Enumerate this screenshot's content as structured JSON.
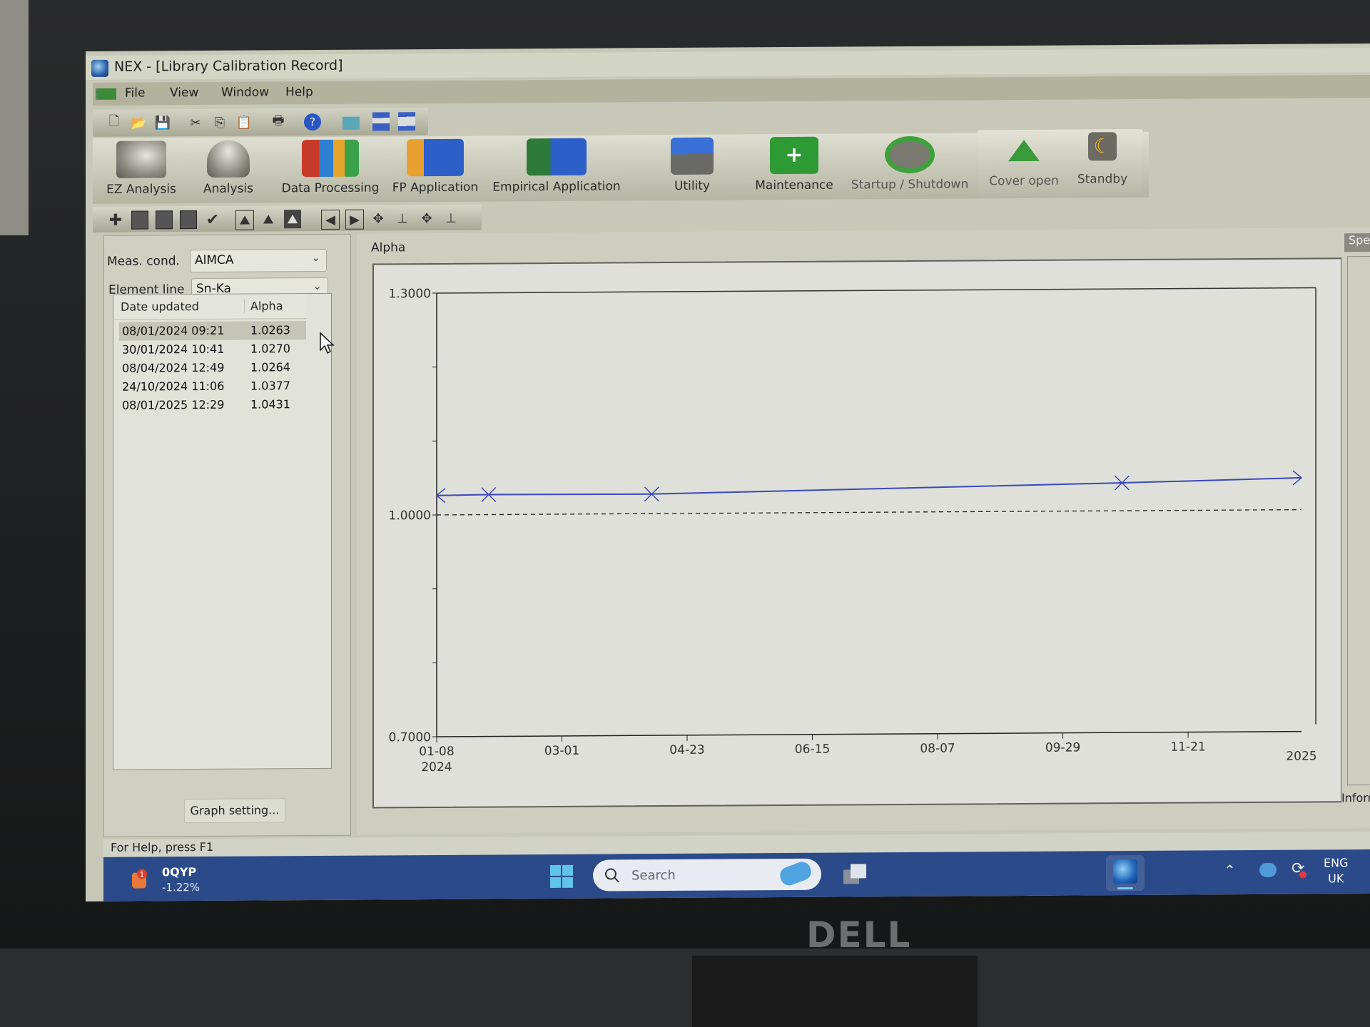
{
  "window": {
    "title": "NEX - [Library Calibration Record]"
  },
  "menu": {
    "items": [
      {
        "label": "File"
      },
      {
        "label": "View"
      },
      {
        "label": "Window"
      },
      {
        "label": "Help"
      }
    ]
  },
  "toolbar_standard": {
    "icons": [
      "new-file-icon",
      "open-folder-icon",
      "save-icon",
      "cut-icon",
      "copy-icon",
      "paste-icon",
      "print-icon",
      "help-icon",
      "window-icon",
      "cascade-icon",
      "tile-icon"
    ]
  },
  "toolbar_main": {
    "buttons": [
      {
        "label": "EZ Analysis",
        "icon": "ez-analysis-icon"
      },
      {
        "label": "Analysis",
        "icon": "analysis-icon"
      },
      {
        "label": "Data Processing",
        "icon": "data-processing-icon"
      },
      {
        "label": "FP Application",
        "icon": "fp-application-icon"
      },
      {
        "label": "Empirical Application",
        "icon": "empirical-application-icon"
      },
      {
        "label": "Utility",
        "icon": "utility-icon"
      },
      {
        "label": "Maintenance",
        "icon": "maintenance-icon"
      },
      {
        "label": "Startup / Shutdown",
        "icon": "power-icon"
      },
      {
        "label": "Cover open",
        "icon": "eject-icon"
      },
      {
        "label": "Standby",
        "icon": "moon-icon"
      }
    ]
  },
  "toolbar_graph": {
    "icons": [
      "add-icon",
      "range-icon",
      "slope-icon",
      "clear-icon",
      "check-icon",
      "peak-icon",
      "peak-baseline-icon",
      "peak-id-icon",
      "prev-icon",
      "next-icon",
      "move-left-icon",
      "move-down-icon",
      "move-center-icon",
      "move-bottom-icon"
    ]
  },
  "left_panel": {
    "meas_cond_label": "Meas. cond.",
    "meas_cond_value": "AlMCA",
    "element_line_label": "Element line",
    "element_line_value": "Sn-Ka",
    "table": {
      "headers": [
        "Date updated",
        "Alpha"
      ],
      "rows": [
        {
          "date": "08/01/2024 09:21",
          "alpha": "1.0263",
          "selected": true
        },
        {
          "date": "30/01/2024 10:41",
          "alpha": "1.0270"
        },
        {
          "date": "08/04/2024 12:49",
          "alpha": "1.0264"
        },
        {
          "date": "24/10/2024 11:06",
          "alpha": "1.0377"
        },
        {
          "date": "08/01/2025 12:29",
          "alpha": "1.0431"
        }
      ]
    },
    "graph_setting_label": "Graph setting..."
  },
  "right_panel": {
    "tab_label": "Spe",
    "info_label": "Inform"
  },
  "chart_data": {
    "type": "line",
    "title": "Alpha",
    "xlabel": "",
    "ylabel": "",
    "ylim": [
      0.7,
      1.3
    ],
    "y_ticks": [
      "1.3000",
      "1.0000",
      "0.7000"
    ],
    "x_ticks": [
      "01-08\n2024",
      "03-01",
      "04-23",
      "06-15",
      "08-07",
      "09-29",
      "11-21",
      "2025"
    ],
    "x_range_days": [
      0,
      366
    ],
    "reference_line": {
      "y": 1.0,
      "style": "dashed"
    },
    "series": [
      {
        "name": "Alpha",
        "color": "#3a48b8",
        "points": [
          {
            "date": "2024-01-08",
            "day": 0,
            "y": 1.0263
          },
          {
            "date": "2024-01-30",
            "day": 22,
            "y": 1.027
          },
          {
            "date": "2024-04-08",
            "day": 91,
            "y": 1.0264
          },
          {
            "date": "2024-10-24",
            "day": 290,
            "y": 1.0377
          },
          {
            "date": "2025-01-08",
            "day": 366,
            "y": 1.0431
          }
        ]
      }
    ],
    "grid": false
  },
  "status_bar": {
    "text": "For Help, press F1"
  },
  "taskbar": {
    "stock_symbol": "0QYP",
    "stock_change": "-1.22%",
    "stock_badge": "1",
    "search_placeholder": "Search",
    "lang_line1": "ENG",
    "lang_line2": "UK"
  },
  "monitor": {
    "brand": "DELL"
  }
}
